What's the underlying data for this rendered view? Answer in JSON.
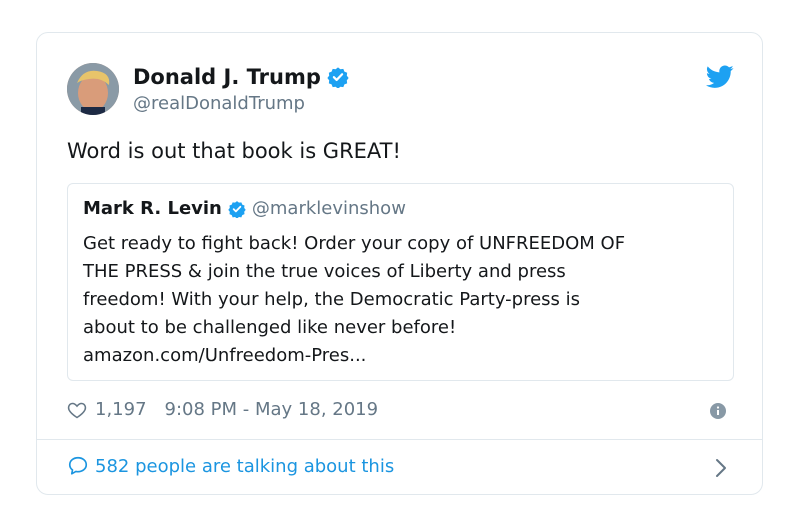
{
  "tweet": {
    "author_name": "Donald J. Trump",
    "author_handle": "@realDonaldTrump",
    "text": "Word is out that book is GREAT!",
    "likes": "1,197",
    "timestamp": "9:08 PM - May 18, 2019",
    "talking": "582 people are talking about this"
  },
  "quote": {
    "author_name": "Mark R. Levin",
    "author_handle": "@marklevinshow",
    "text": "Get ready to fight back! Order your copy of UNFREEDOM OF\nTHE PRESS & join the true voices of Liberty and press\nfreedom! With your help, the Democratic Party-press is\nabout to be challenged like never before!\namazon.com/Unfreedom-Pres..."
  },
  "icons": [
    "verified-icon",
    "twitter-bird-icon",
    "heart-icon",
    "info-icon",
    "reply-bubble-icon",
    "chevron-right-icon"
  ],
  "colors": {
    "accent": "#1da1f2",
    "link": "#1b95e0",
    "muted": "#657786",
    "border": "#e1e8ed"
  }
}
